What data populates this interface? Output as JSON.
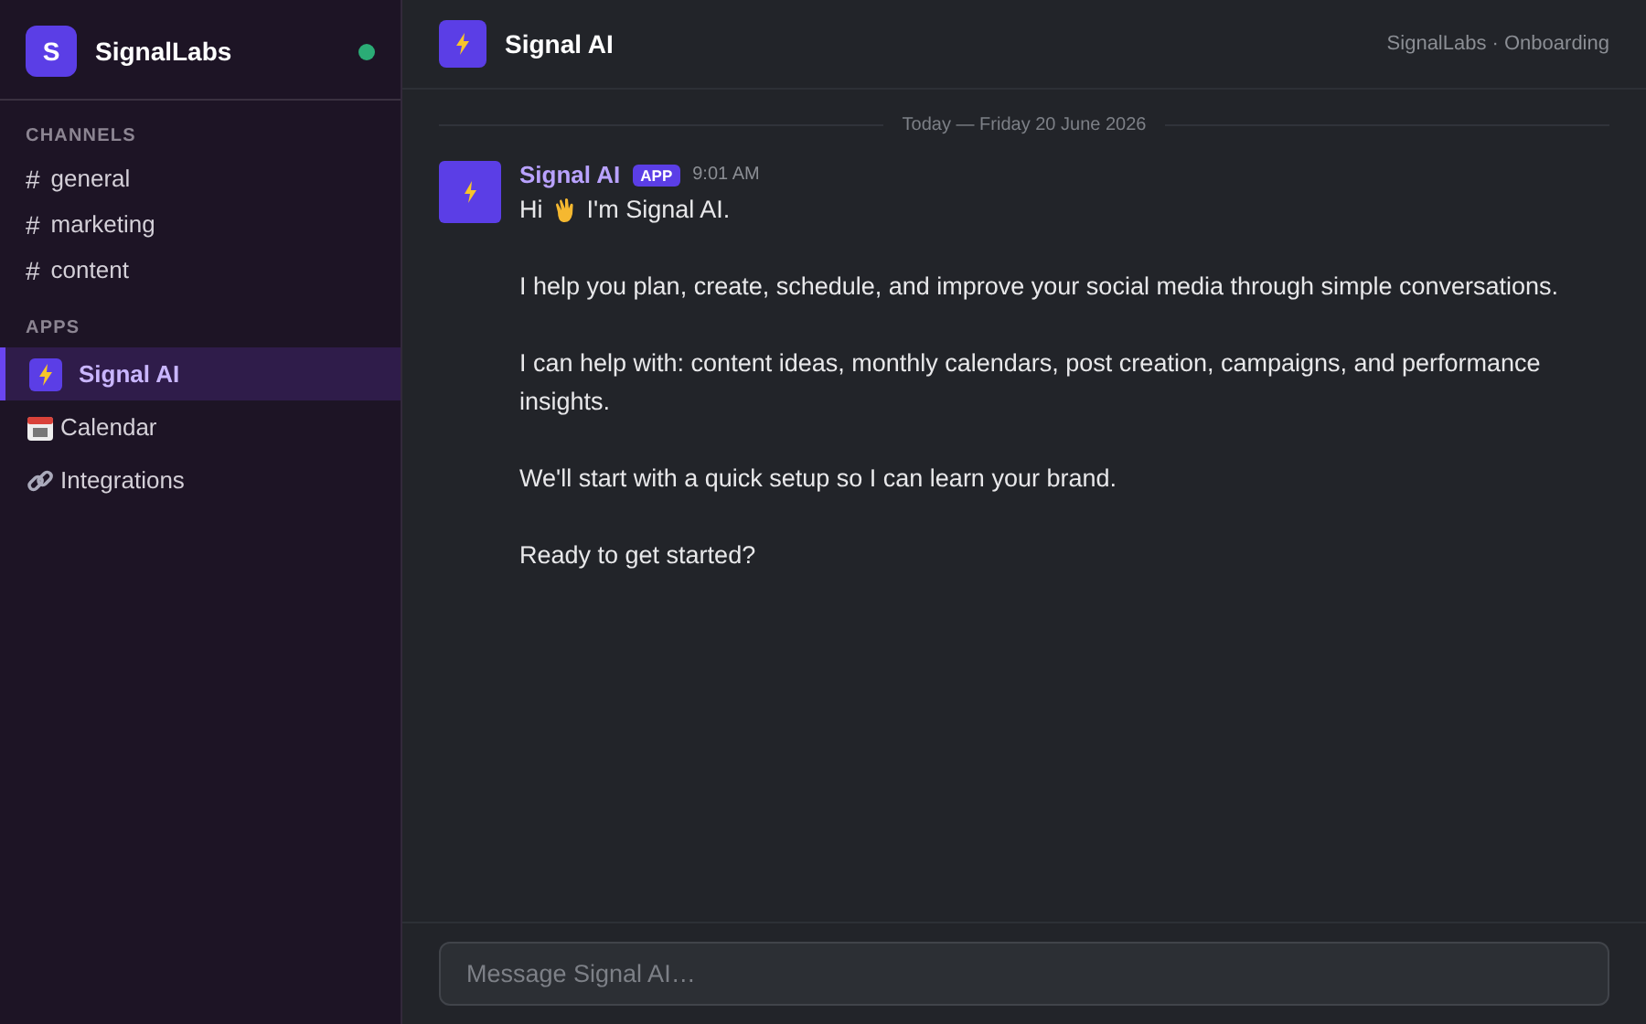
{
  "workspace": {
    "initial": "S",
    "name": "SignalLabs",
    "online": true
  },
  "sidebar": {
    "sections": [
      {
        "title": "CHANNELS",
        "items": [
          {
            "kind": "channel",
            "prefix": "#",
            "label": "general",
            "selected": false
          },
          {
            "kind": "channel",
            "prefix": "#",
            "label": "marketing",
            "selected": false
          },
          {
            "kind": "channel",
            "prefix": "#",
            "label": "content",
            "selected": false
          }
        ]
      },
      {
        "title": "APPS",
        "items": [
          {
            "kind": "app",
            "label": "Signal AI",
            "selected": true
          },
          {
            "kind": "app",
            "label": "Calendar",
            "selected": false
          },
          {
            "kind": "app",
            "label": "Integrations",
            "selected": false
          }
        ]
      }
    ]
  },
  "header": {
    "title": "Signal AI",
    "breadcrumb": "SignalLabs · Onboarding"
  },
  "date_divider": "Today — Friday 20 June 2026",
  "message": {
    "author": "Signal AI",
    "badge": "APP",
    "time": "9:01 AM",
    "greeting_start": "Hi",
    "greeting_end": "I'm Signal AI.",
    "paragraphs": [
      "I help you plan, create, schedule, and improve your social media through simple conversations.",
      "I can help with: content ideas, monthly calendars, post creation, campaigns, and performance insights.",
      "We'll start with a quick setup so I can learn your brand.",
      "Ready to get started?"
    ]
  },
  "composer": {
    "placeholder": "Message Signal AI…"
  }
}
